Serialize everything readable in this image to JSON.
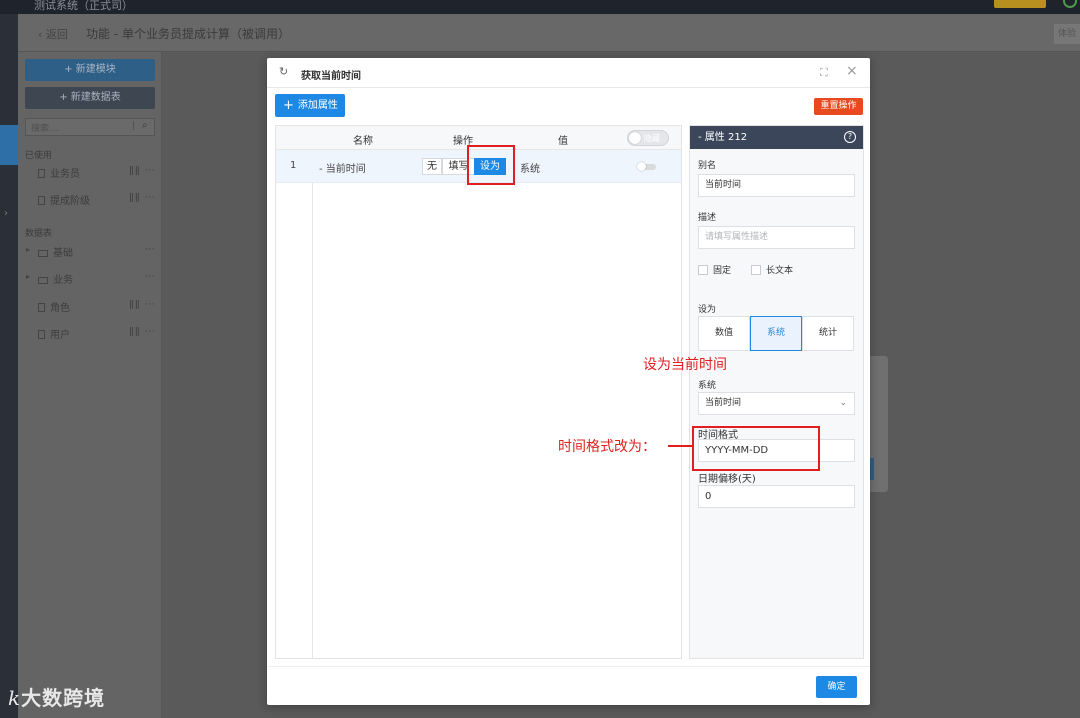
{
  "background": {
    "system_name": "测试系统（正式司）",
    "back_label": "返回",
    "page_title": "功能 - 单个业务员提成计算（被调用）",
    "trial_label": "体验",
    "sidebar": {
      "new_module": "+ 新建模块",
      "new_table": "+ 新建数据表",
      "search_placeholder": "搜索...",
      "section_used": "已使用",
      "used_items": [
        "业务员",
        "提成阶级"
      ],
      "section_tables": "数据表",
      "folders": [
        "基础",
        "业务"
      ],
      "table_items": [
        "角色",
        "用户"
      ]
    }
  },
  "modal": {
    "title": "获取当前时间",
    "add_property": "添加属性",
    "reset_action": "重置操作",
    "table": {
      "columns": [
        "名称",
        "操作",
        "值"
      ],
      "hide_toggle": "隐藏",
      "rows": [
        {
          "index": "1",
          "name": "- 当前时间",
          "ops": [
            "无",
            "填写",
            "设为"
          ],
          "value": "系统"
        }
      ]
    },
    "panel": {
      "title": "- 属性 212",
      "help": "?",
      "alias_label": "别名",
      "alias_value": "当前时间",
      "desc_label": "描述",
      "desc_placeholder": "请填写属性描述",
      "fixed_label": "固定",
      "longtext_label": "长文本",
      "setto_label": "设为",
      "setto_options": [
        "数值",
        "系统",
        "统计"
      ],
      "system_label": "系统",
      "system_value": "当前时间",
      "time_format_label": "时间格式",
      "time_format_value": "YYYY-MM-DD",
      "date_offset_label": "日期偏移(天)",
      "date_offset_value": "0"
    },
    "ok": "确定"
  },
  "annotations": {
    "set_current_time": "设为当前时间",
    "change_format": "时间格式改为："
  },
  "watermark": {
    "logo_letters": "k",
    "logo_text": "大数跨境"
  },
  "colors": {
    "primary": "#1e88e5",
    "danger": "#e8491f",
    "annotation": "#e02020",
    "panel_header": "#3b465a"
  }
}
